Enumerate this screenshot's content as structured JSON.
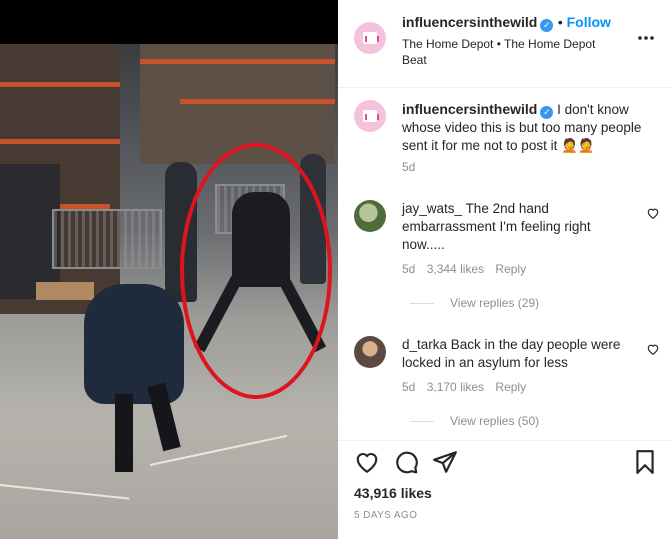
{
  "post": {
    "author": "influencersinthewild",
    "follow_label": "Follow",
    "location": "The Home Depot • The Home Depot Beat",
    "likes": "43,916 likes",
    "date": "5 DAYS AGO"
  },
  "caption": {
    "author": "influencersinthewild",
    "text": "I don't know whose video this is but too many people sent it for me not to post it 🤦🤦",
    "age": "5d"
  },
  "comments": [
    {
      "author": "jay_wats_",
      "text": "The 2nd hand embarrassment I'm feeling right now.....",
      "age": "5d",
      "likes": "3,344 likes",
      "reply_label": "Reply",
      "view_replies": "View replies (29)"
    },
    {
      "author": "d_tarka",
      "text": "Back in the day people were locked in an asylum for less",
      "age": "5d",
      "likes": "3,170 likes",
      "reply_label": "Reply",
      "view_replies": "View replies (50)"
    }
  ],
  "icons": {
    "more": "more-options-icon",
    "like": "heart-icon",
    "comment": "comment-icon",
    "share": "share-icon",
    "save": "bookmark-icon",
    "verified": "verified-badge-icon"
  },
  "colors": {
    "accent": "#0095f6",
    "highlight_ring": "#e0141a",
    "verified": "#3897f0"
  }
}
